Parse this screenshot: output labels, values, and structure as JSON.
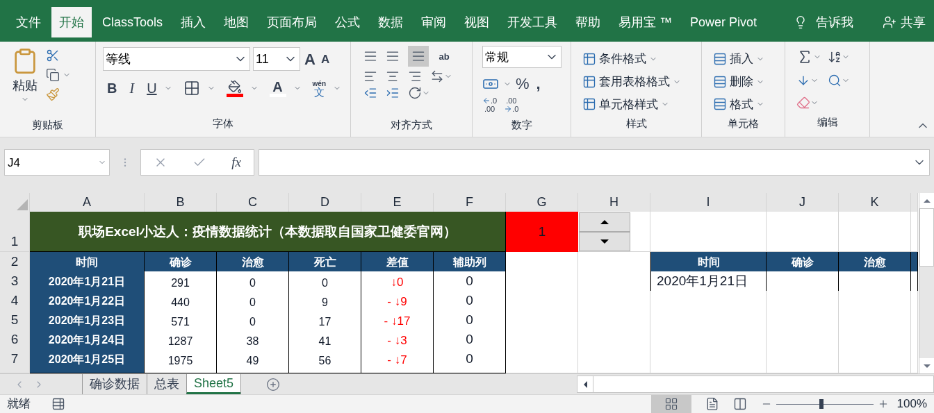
{
  "menu_tabs": [
    {
      "label": "文件",
      "selected": false
    },
    {
      "label": "开始",
      "selected": true
    },
    {
      "label": "ClassTools",
      "selected": false
    },
    {
      "label": "插入",
      "selected": false
    },
    {
      "label": "地图",
      "selected": false
    },
    {
      "label": "页面布局",
      "selected": false
    },
    {
      "label": "公式",
      "selected": false
    },
    {
      "label": "数据",
      "selected": false
    },
    {
      "label": "审阅",
      "selected": false
    },
    {
      "label": "视图",
      "selected": false
    },
    {
      "label": "开发工具",
      "selected": false
    },
    {
      "label": "帮助",
      "selected": false
    },
    {
      "label": "易用宝 ™",
      "selected": false
    },
    {
      "label": "Power Pivot",
      "selected": false
    }
  ],
  "tell_me": "告诉我",
  "share": "共享",
  "ribbon": {
    "clipboard": {
      "label": "剪贴板",
      "paste": "粘贴"
    },
    "font": {
      "label": "字体",
      "font_name": "等线",
      "font_size": "11",
      "bold": "B",
      "italic": "I",
      "underline": "U",
      "font_color": "A",
      "phonetic_top": "wén",
      "phonetic_bottom": "文",
      "grow": "A",
      "shrink": "A"
    },
    "alignment": {
      "label": "对齐方式",
      "wrap": "ab"
    },
    "number": {
      "label": "数字",
      "format": "常规",
      "percent": "%",
      "comma": ",",
      "increase_decimal": [
        ".0",
        ".00"
      ],
      "decrease_decimal": [
        ".00",
        ".0"
      ]
    },
    "styles": {
      "label": "样式",
      "items": [
        "条件格式",
        "套用表格格式",
        "单元格样式"
      ]
    },
    "cells": {
      "label": "单元格",
      "items": [
        "插入",
        "删除",
        "格式"
      ]
    },
    "editing": {
      "label": "编辑"
    }
  },
  "formula_bar": {
    "name_box": "J4",
    "function_label": "fx"
  },
  "sheet": {
    "columns": [
      "A",
      "B",
      "C",
      "D",
      "E",
      "F",
      "G",
      "H",
      "I",
      "J",
      "K"
    ],
    "row_numbers": [
      "1",
      "2",
      "3",
      "4",
      "5",
      "6",
      "7"
    ],
    "title": "职场Excel小达人：疫情数据统计（本数据取自国家卫健委官网）",
    "counter": "1",
    "headers": [
      "时间",
      "确诊",
      "治愈",
      "死亡",
      "差值",
      "辅助列"
    ],
    "rows": [
      {
        "date": "2020年1月21日",
        "confirmed": "291",
        "cured": "0",
        "deaths": "0",
        "diff": "↓0",
        "helper": "0"
      },
      {
        "date": "2020年1月22日",
        "confirmed": "440",
        "cured": "0",
        "deaths": "9",
        "diff": "- ↓9",
        "helper": "0"
      },
      {
        "date": "2020年1月23日",
        "confirmed": "571",
        "cured": "0",
        "deaths": "17",
        "diff": "- ↓17",
        "helper": "0"
      },
      {
        "date": "2020年1月24日",
        "confirmed": "1287",
        "cured": "38",
        "deaths": "41",
        "diff": "- ↓3",
        "helper": "0"
      },
      {
        "date": "2020年1月25日",
        "confirmed": "1975",
        "cured": "49",
        "deaths": "56",
        "diff": "- ↓7",
        "helper": "0"
      }
    ],
    "lookup_headers": [
      "时间",
      "确诊",
      "治愈"
    ],
    "lookup_date": "2020年1月21日"
  },
  "sheet_tabs": [
    {
      "label": "确诊数据",
      "selected": false
    },
    {
      "label": "总表",
      "selected": false
    },
    {
      "label": "Sheet5",
      "selected": true
    }
  ],
  "status_bar": {
    "status": "就绪",
    "zoom": "100%",
    "level": 0.47
  }
}
